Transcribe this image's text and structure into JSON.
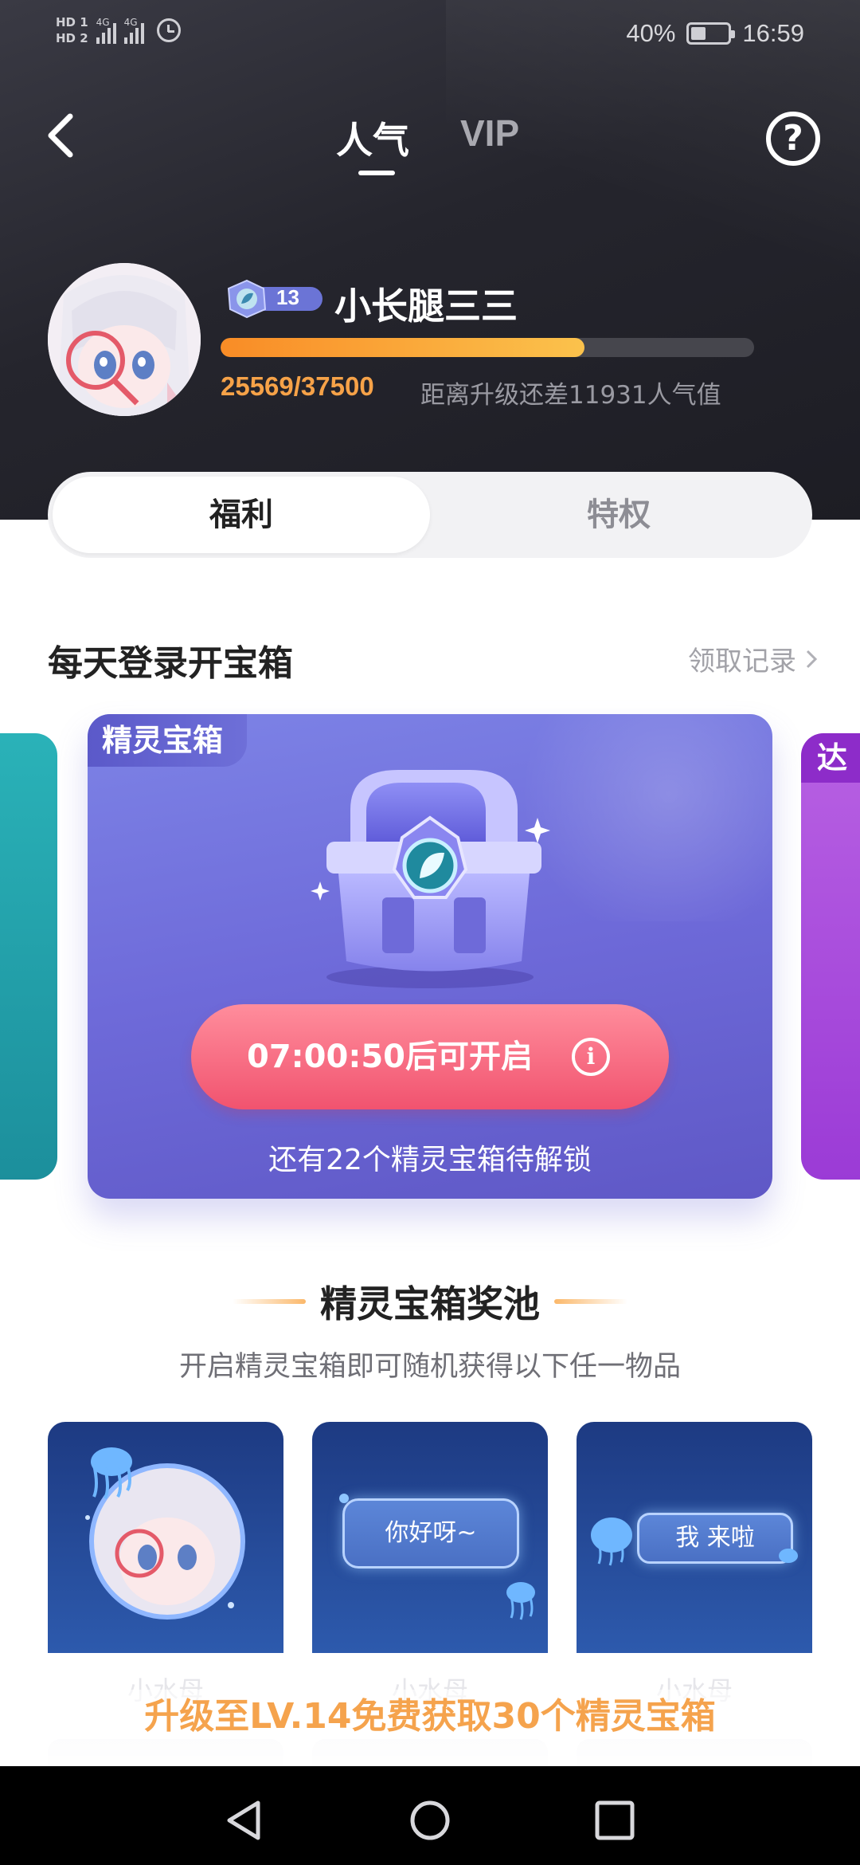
{
  "status_bar": {
    "hd1": "HD 1",
    "hd2": "HD 2",
    "net1": "4G",
    "net2": "4G",
    "battery_percent": "40%",
    "battery_level": 0.4,
    "time": "16:59"
  },
  "nav": {
    "tabs": [
      {
        "label": "人气",
        "active": true
      },
      {
        "label": "VIP",
        "active": false
      }
    ],
    "help_label": "?"
  },
  "profile": {
    "level": "13",
    "name": "小长腿三三",
    "progress_current": 25569,
    "progress_target": 37500,
    "progress_text": "25569/37500",
    "progress_hint": "距离升级还差11931人气值"
  },
  "segment": {
    "items": [
      {
        "label": "福利",
        "active": true
      },
      {
        "label": "特权",
        "active": false
      }
    ]
  },
  "daily_section": {
    "title": "每天登录开宝箱",
    "link_label": "领取记录"
  },
  "carousel": {
    "right_card_tag": "达",
    "main_card": {
      "tag": "精灵宝箱",
      "button_label": "07:00:50后可开启",
      "info_icon": "i",
      "note": "还有22个精灵宝箱待解锁"
    }
  },
  "pool": {
    "title": "精灵宝箱奖池",
    "subtitle": "开启精灵宝箱即可随机获得以下任一物品",
    "prizes": [
      {
        "label": "小水母",
        "kind": "avatar-frame"
      },
      {
        "label": "小水母",
        "kind": "chat-bubble",
        "bubble_text": "你好呀~"
      },
      {
        "label": "小水母",
        "kind": "entry-banner",
        "bubble_text": "我  来啦"
      }
    ]
  },
  "promo": {
    "text": "升级至LV.14免费获取30个精灵宝箱"
  },
  "colors": {
    "header_bg": "#25252d",
    "accent_orange": "#f6a248",
    "card_purple": "#6e6ad9",
    "button_pink": "#f1536f",
    "prize_blue": "#2d5aad"
  }
}
